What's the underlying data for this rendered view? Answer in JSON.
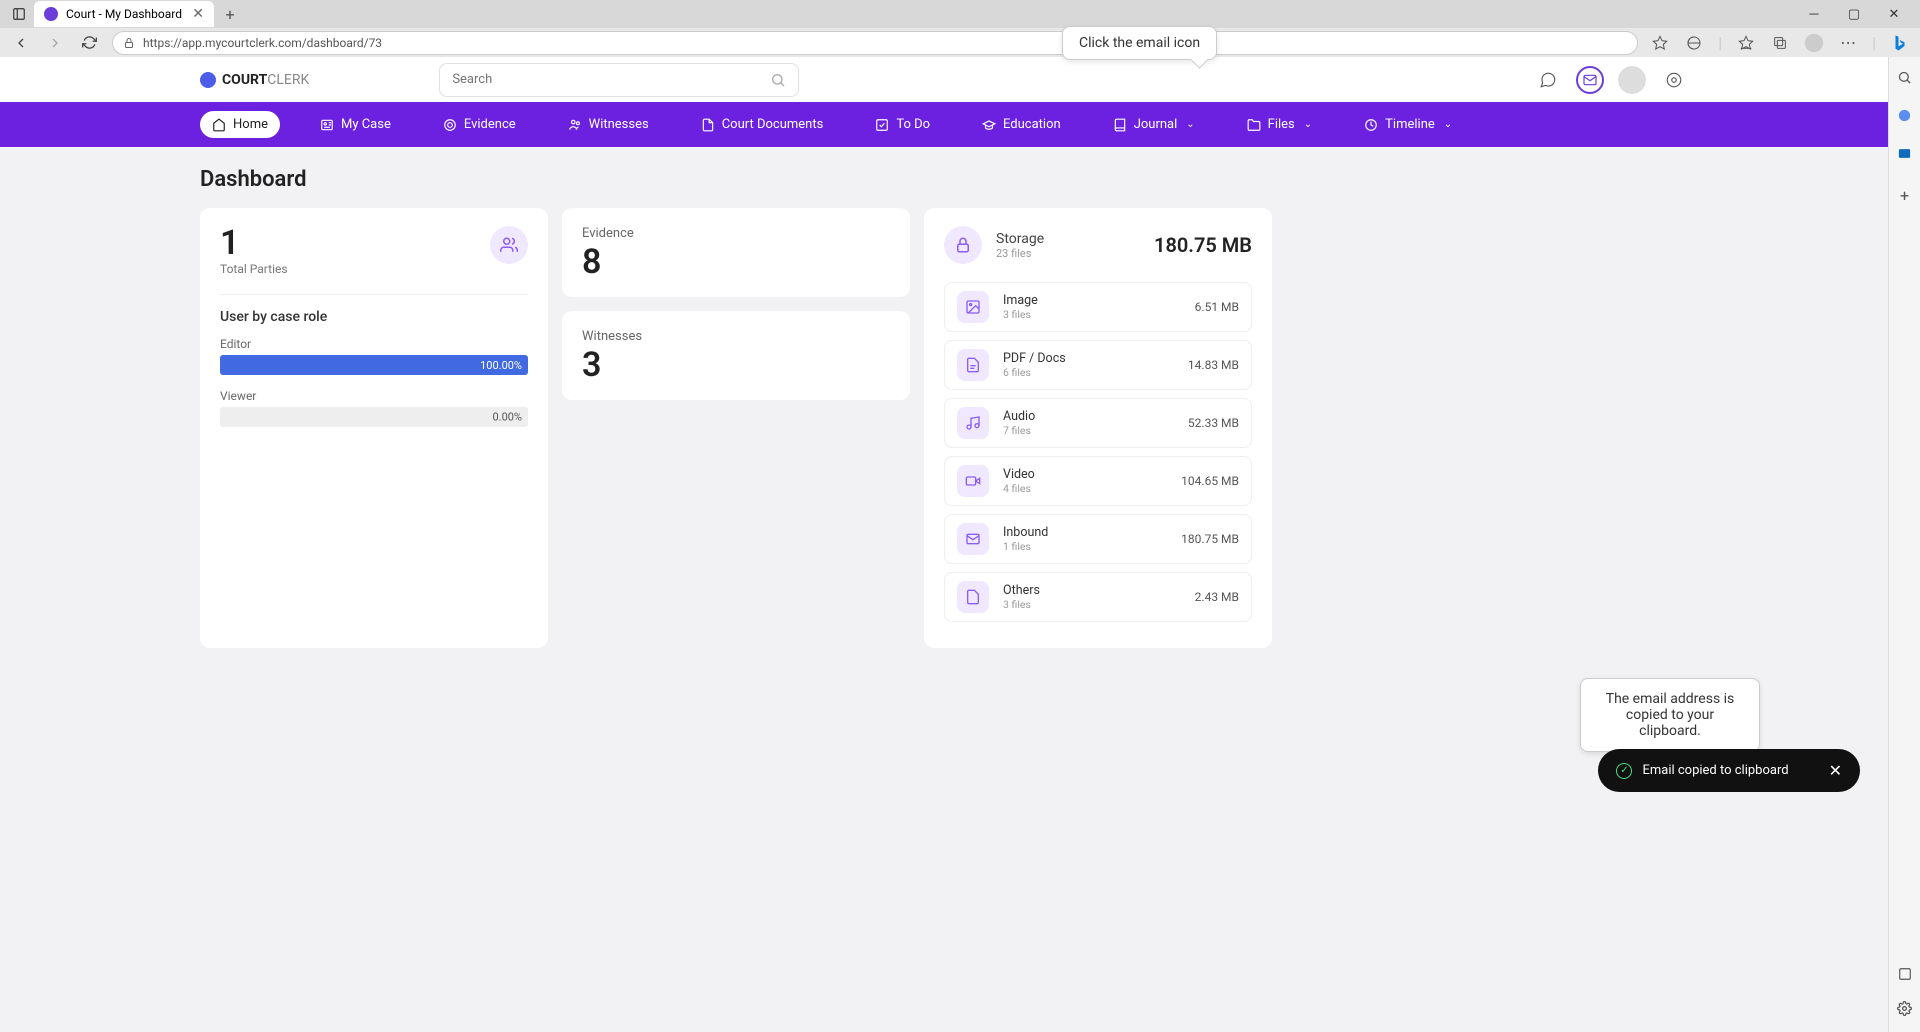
{
  "browser": {
    "tab_title": "Court - My Dashboard",
    "url": "https://app.mycourtclerk.com/dashboard/73"
  },
  "callouts": {
    "top": "Click the email icon",
    "bottom": "The email address is copied to your clipboard."
  },
  "toast": {
    "message": "Email copied to clipboard"
  },
  "header": {
    "logo_bold": "COURT",
    "logo_light": "CLERK",
    "search_placeholder": "Search"
  },
  "nav": [
    {
      "label": "Home",
      "icon": "home",
      "active": true,
      "dropdown": false
    },
    {
      "label": "My Case",
      "icon": "id",
      "active": false,
      "dropdown": false
    },
    {
      "label": "Evidence",
      "icon": "target",
      "active": false,
      "dropdown": false
    },
    {
      "label": "Witnesses",
      "icon": "users",
      "active": false,
      "dropdown": false
    },
    {
      "label": "Court Documents",
      "icon": "doc",
      "active": false,
      "dropdown": false
    },
    {
      "label": "To Do",
      "icon": "check",
      "active": false,
      "dropdown": false
    },
    {
      "label": "Education",
      "icon": "grad",
      "active": false,
      "dropdown": false
    },
    {
      "label": "Journal",
      "icon": "book",
      "active": false,
      "dropdown": true
    },
    {
      "label": "Files",
      "icon": "folder",
      "active": false,
      "dropdown": true
    },
    {
      "label": "Timeline",
      "icon": "clock",
      "active": false,
      "dropdown": true
    }
  ],
  "page": {
    "title": "Dashboard"
  },
  "parties": {
    "count": "1",
    "label": "Total Parties",
    "section_title": "User by case role",
    "roles": [
      {
        "name": "Editor",
        "percent": "100.00%",
        "width": "100%"
      },
      {
        "name": "Viewer",
        "percent": "0.00%",
        "width": "0%"
      }
    ]
  },
  "evidence": {
    "label": "Evidence",
    "count": "8"
  },
  "witnesses": {
    "label": "Witnesses",
    "count": "3"
  },
  "storage": {
    "title": "Storage",
    "subtitle": "23 files",
    "total": "180.75 MB",
    "items": [
      {
        "name": "Image",
        "count": "3 files",
        "size": "6.51 MB",
        "icon": "image"
      },
      {
        "name": "PDF / Docs",
        "count": "6 files",
        "size": "14.83 MB",
        "icon": "doc"
      },
      {
        "name": "Audio",
        "count": "7 files",
        "size": "52.33 MB",
        "icon": "audio"
      },
      {
        "name": "Video",
        "count": "4 files",
        "size": "104.65 MB",
        "icon": "video"
      },
      {
        "name": "Inbound",
        "count": "1 files",
        "size": "180.75 MB",
        "icon": "mail"
      },
      {
        "name": "Others",
        "count": "3 files",
        "size": "2.43 MB",
        "icon": "file"
      }
    ]
  }
}
